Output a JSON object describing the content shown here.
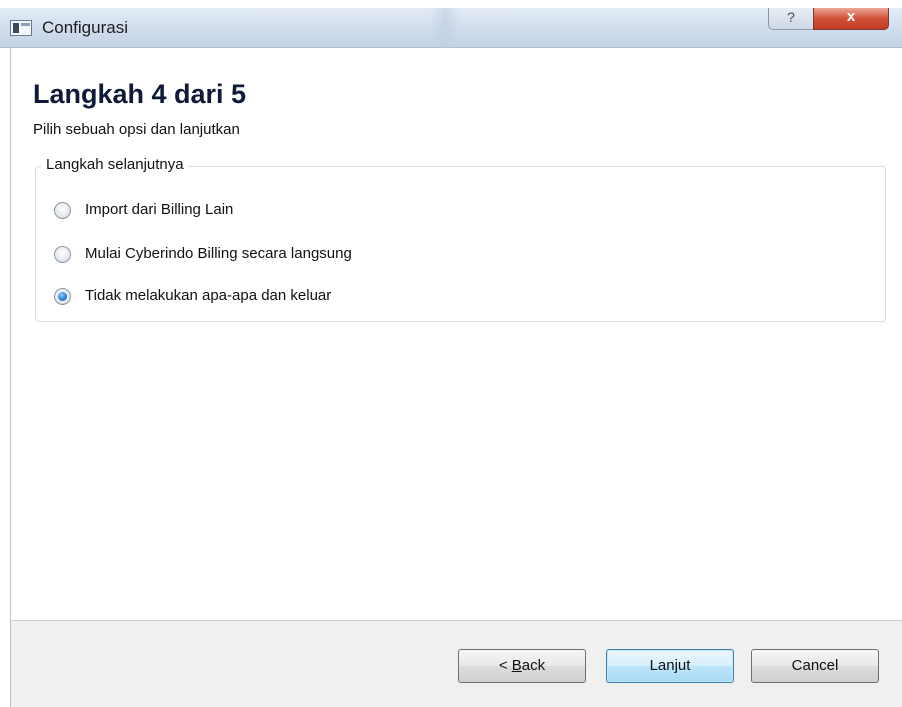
{
  "window": {
    "title": "Configurasi",
    "help_glyph": "?",
    "close_glyph": "x"
  },
  "page": {
    "heading": "Langkah 4 dari 5",
    "subheading": "Pilih sebuah opsi dan lanjutkan"
  },
  "group": {
    "legend": "Langkah selanjutnya",
    "options": [
      {
        "label": "Import dari Billing Lain",
        "checked": false
      },
      {
        "label": "Mulai Cyberindo Billing secara langsung",
        "checked": false
      },
      {
        "label": "Tidak melakukan apa-apa dan keluar",
        "checked": true
      }
    ]
  },
  "buttons": {
    "back_prefix": "< ",
    "back_mnemonic": "B",
    "back_rest": "ack",
    "next": "Lanjut",
    "cancel": "Cancel"
  },
  "colors": {
    "heading": "#0f1a3a",
    "default_button_border": "#3c7fb1",
    "close_button": "#c33a22"
  },
  "icons": {
    "app": "app-window-icon",
    "help": "question-mark-icon",
    "close": "close-x-icon"
  }
}
